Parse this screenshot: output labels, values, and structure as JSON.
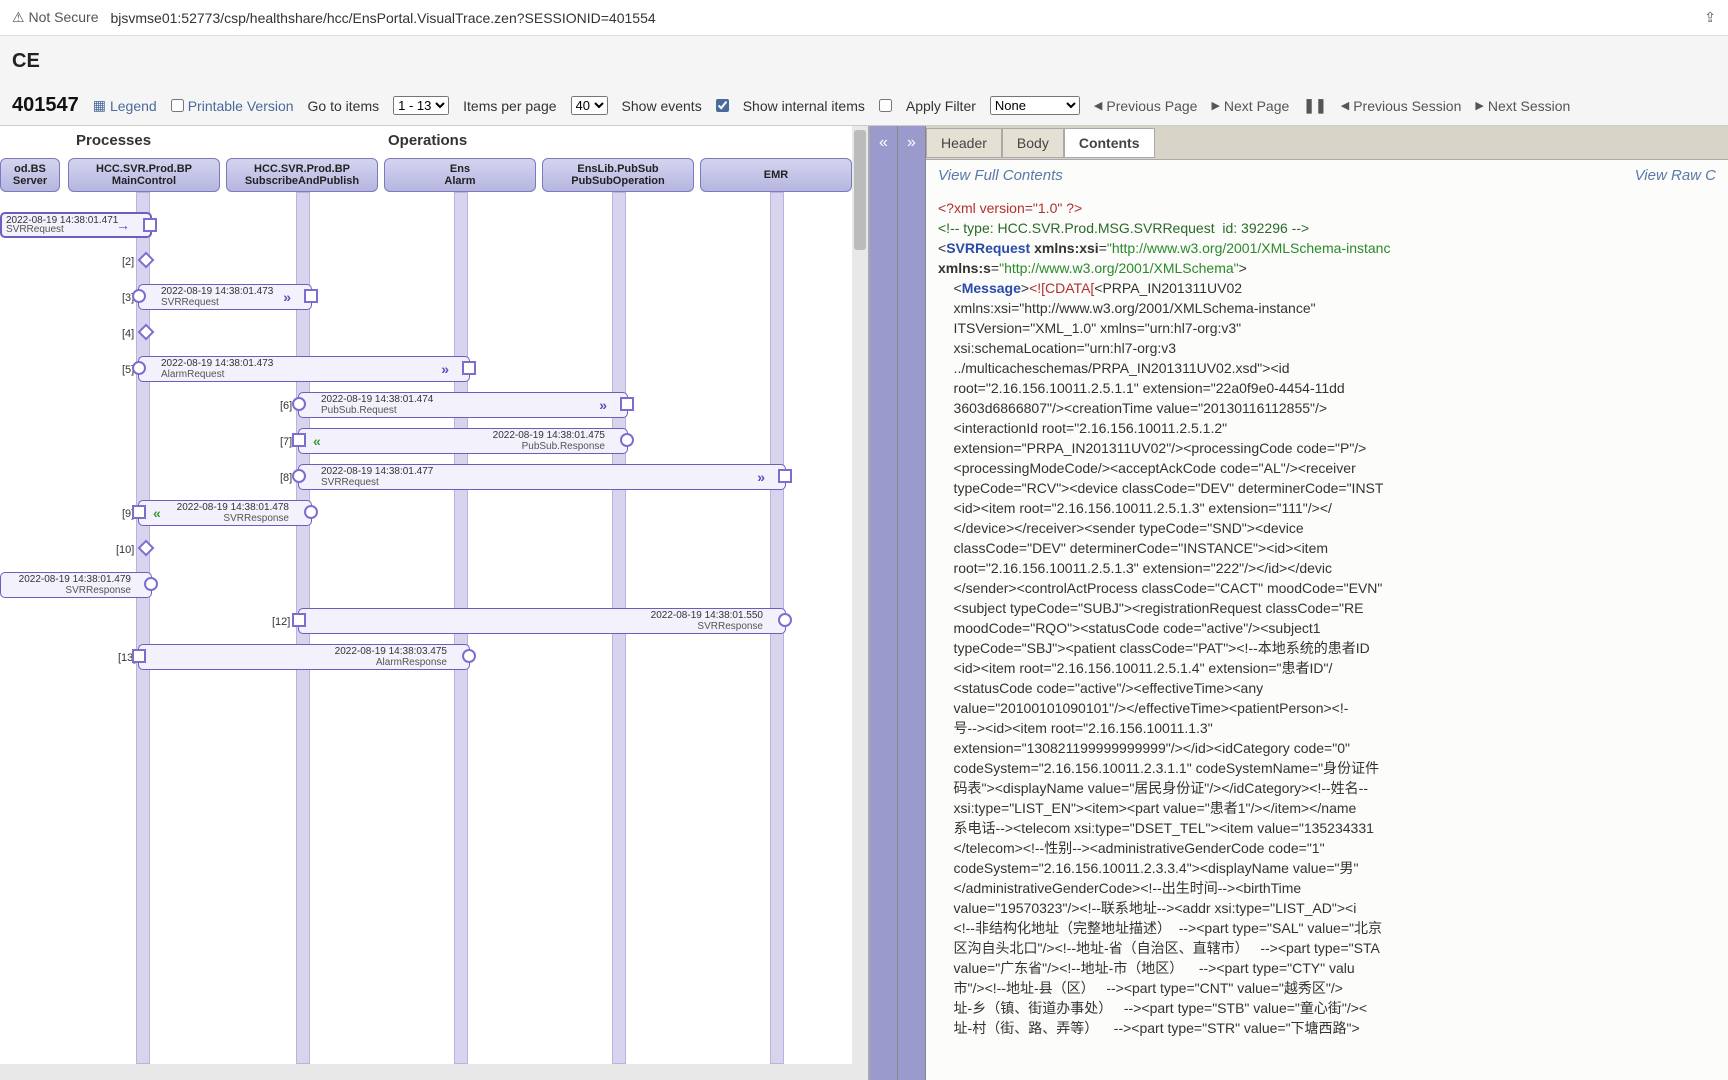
{
  "addr": {
    "secure": "Not Secure",
    "url": "bjsvmse01:52773/csp/healthshare/hcc/EnsPortal.VisualTrace.zen?SESSIONID=401554"
  },
  "page_title_suffix": "CE",
  "toolbar": {
    "session_id": "401547",
    "legend": "Legend",
    "printable": "Printable Version",
    "goto": "Go to items",
    "goto_range": "1 - 13",
    "per_page_label": "Items per page",
    "per_page_value": "40",
    "show_events": "Show events",
    "show_internal": "Show internal items",
    "apply_filter": "Apply Filter",
    "filter_value": "None",
    "prev_page": "Previous Page",
    "next_page": "Next Page",
    "prev_session": "Previous Session",
    "next_session": "Next Session"
  },
  "sections": {
    "services": "",
    "processes": "Processes",
    "operations": "Operations"
  },
  "lanes": [
    {
      "l1": "od.BS",
      "l2": "Server"
    },
    {
      "l1": "HCC.SVR.Prod.BP",
      "l2": "MainControl"
    },
    {
      "l1": "HCC.SVR.Prod.BP",
      "l2": "SubscribeAndPublish"
    },
    {
      "l1": "Ens",
      "l2": "Alarm"
    },
    {
      "l1": "EnsLib.PubSub",
      "l2": "PubSubOperation"
    },
    {
      "l1": "EMR",
      "l2": ""
    }
  ],
  "msgs": [
    {
      "i": "",
      "ts": "2022-08-19 14:38:01.471",
      "mt": "SVRRequest"
    },
    {
      "i": "[2]"
    },
    {
      "i": "[3]",
      "ts": "2022-08-19 14:38:01.473",
      "mt": "SVRRequest"
    },
    {
      "i": "[4]"
    },
    {
      "i": "[5]",
      "ts": "2022-08-19 14:38:01.473",
      "mt": "AlarmRequest"
    },
    {
      "i": "[6]",
      "ts": "2022-08-19 14:38:01.474",
      "mt": "PubSub.Request"
    },
    {
      "i": "[7]",
      "ts": "2022-08-19 14:38:01.475",
      "mt": "PubSub.Response"
    },
    {
      "i": "[8]",
      "ts": "2022-08-19 14:38:01.477",
      "mt": "SVRRequest"
    },
    {
      "i": "[9]",
      "ts": "2022-08-19 14:38:01.478",
      "mt": "SVRResponse"
    },
    {
      "i": "",
      "ts": "2022-08-19 14:38:01.479",
      "mt": "SVRResponse"
    },
    {
      "i": "[12]",
      "ts": "2022-08-19 14:38:01.550",
      "mt": "SVRResponse"
    },
    {
      "i": "[13]",
      "ts": "2022-08-19 14:38:03.475",
      "mt": "AlarmResponse"
    }
  ],
  "detail": {
    "tabs": {
      "header": "Header",
      "body": "Body",
      "contents": "Contents"
    },
    "view_full": "View Full Contents",
    "view_raw": "View Raw C",
    "xml_lines": [
      {
        "c": "x-red",
        "t": "<?xml version=\"1.0\" ?>"
      },
      {
        "c": "x-dgreen",
        "t": "<!-- type: HCC.SVR.Prod.MSG.SVRRequest  id: 392296 -->"
      },
      {
        "c": "mix1",
        "t": "<SVRRequest xmlns:xsi=\"http://www.w3.org/2001/XMLSchema-instanc"
      },
      {
        "c": "mix2",
        "t": "xmlns:s=\"http://www.w3.org/2001/XMLSchema\">"
      },
      {
        "c": "body",
        "t": "    <Message><![CDATA[<PRPA_IN201311UV02"
      },
      {
        "c": "body",
        "t": "    xmlns:xsi=\"http://www.w3.org/2001/XMLSchema-instance\""
      },
      {
        "c": "body",
        "t": "    ITSVersion=\"XML_1.0\" xmlns=\"urn:hl7-org:v3\""
      },
      {
        "c": "body",
        "t": "    xsi:schemaLocation=\"urn:hl7-org:v3"
      },
      {
        "c": "body",
        "t": "    ../multicacheschemas/PRPA_IN201311UV02.xsd\"><id"
      },
      {
        "c": "body",
        "t": "    root=\"2.16.156.10011.2.5.1.1\" extension=\"22a0f9e0-4454-11dd"
      },
      {
        "c": "body",
        "t": "    3603d6866807\"/><creationTime value=\"20130116112855\"/>"
      },
      {
        "c": "body",
        "t": "    <interactionId root=\"2.16.156.10011.2.5.1.2\""
      },
      {
        "c": "body",
        "t": "    extension=\"PRPA_IN201311UV02\"/><processingCode code=\"P\"/>"
      },
      {
        "c": "body",
        "t": "    <processingModeCode/><acceptAckCode code=\"AL\"/><receiver"
      },
      {
        "c": "body",
        "t": "    typeCode=\"RCV\"><device classCode=\"DEV\" determinerCode=\"INST"
      },
      {
        "c": "body",
        "t": "    <id><item root=\"2.16.156.10011.2.5.1.3\" extension=\"111\"/></"
      },
      {
        "c": "body",
        "t": "    </device></receiver><sender typeCode=\"SND\"><device"
      },
      {
        "c": "body",
        "t": "    classCode=\"DEV\" determinerCode=\"INSTANCE\"><id><item"
      },
      {
        "c": "body",
        "t": "    root=\"2.16.156.10011.2.5.1.3\" extension=\"222\"/></id></devic"
      },
      {
        "c": "body",
        "t": "    </sender><controlActProcess classCode=\"CACT\" moodCode=\"EVN\""
      },
      {
        "c": "body",
        "t": "    <subject typeCode=\"SUBJ\"><registrationRequest classCode=\"RE"
      },
      {
        "c": "body",
        "t": "    moodCode=\"RQO\"><statusCode code=\"active\"/><subject1"
      },
      {
        "c": "body",
        "t": "    typeCode=\"SBJ\"><patient classCode=\"PAT\"><!--本地系统的患者ID"
      },
      {
        "c": "body",
        "t": "    <id><item root=\"2.16.156.10011.2.5.1.4\" extension=\"患者ID\"/"
      },
      {
        "c": "body",
        "t": "    <statusCode code=\"active\"/><effectiveTime><any"
      },
      {
        "c": "body",
        "t": "    value=\"20100101090101\"/></effectiveTime><patientPerson><!-"
      },
      {
        "c": "body",
        "t": "    号--><id><item root=\"2.16.156.10011.1.3\""
      },
      {
        "c": "body",
        "t": "    extension=\"130821199999999999\"/></id><idCategory code=\"0\""
      },
      {
        "c": "body",
        "t": "    codeSystem=\"2.16.156.10011.2.3.1.1\" codeSystemName=\"身份证件"
      },
      {
        "c": "body",
        "t": "    码表\"><displayName value=\"居民身份证\"/></idCategory><!--姓名--"
      },
      {
        "c": "body",
        "t": "    xsi:type=\"LIST_EN\"><item><part value=\"患者1\"/></item></name"
      },
      {
        "c": "body",
        "t": "    系电话--><telecom xsi:type=\"DSET_TEL\"><item value=\"135234331"
      },
      {
        "c": "body",
        "t": "    </telecom><!--性别--><administrativeGenderCode code=\"1\""
      },
      {
        "c": "body",
        "t": "    codeSystem=\"2.16.156.10011.2.3.3.4\"><displayName value=\"男\""
      },
      {
        "c": "body",
        "t": "    </administrativeGenderCode><!--出生时间--><birthTime"
      },
      {
        "c": "body",
        "t": "    value=\"19570323\"/><!--联系地址--><addr xsi:type=\"LIST_AD\"><i"
      },
      {
        "c": "body",
        "t": "    <!--非结构化地址（完整地址描述）  --><part type=\"SAL\" value=\"北京"
      },
      {
        "c": "body",
        "t": "    区沟自头北口\"/><!--地址-省（自治区、直辖市）   --><part type=\"STA"
      },
      {
        "c": "body",
        "t": "    value=\"广东省\"/><!--地址-市（地区）    --><part type=\"CTY\" valu"
      },
      {
        "c": "body",
        "t": "    市\"/><!--地址-县（区）   --><part type=\"CNT\" value=\"越秀区\"/>"
      },
      {
        "c": "body",
        "t": "    址-乡（镇、街道办事处）   --><part type=\"STB\" value=\"童心街\"/><"
      },
      {
        "c": "body",
        "t": "    址-村（街、路、弄等）    --><part type=\"STR\" value=\"下塘西路\">"
      }
    ]
  }
}
